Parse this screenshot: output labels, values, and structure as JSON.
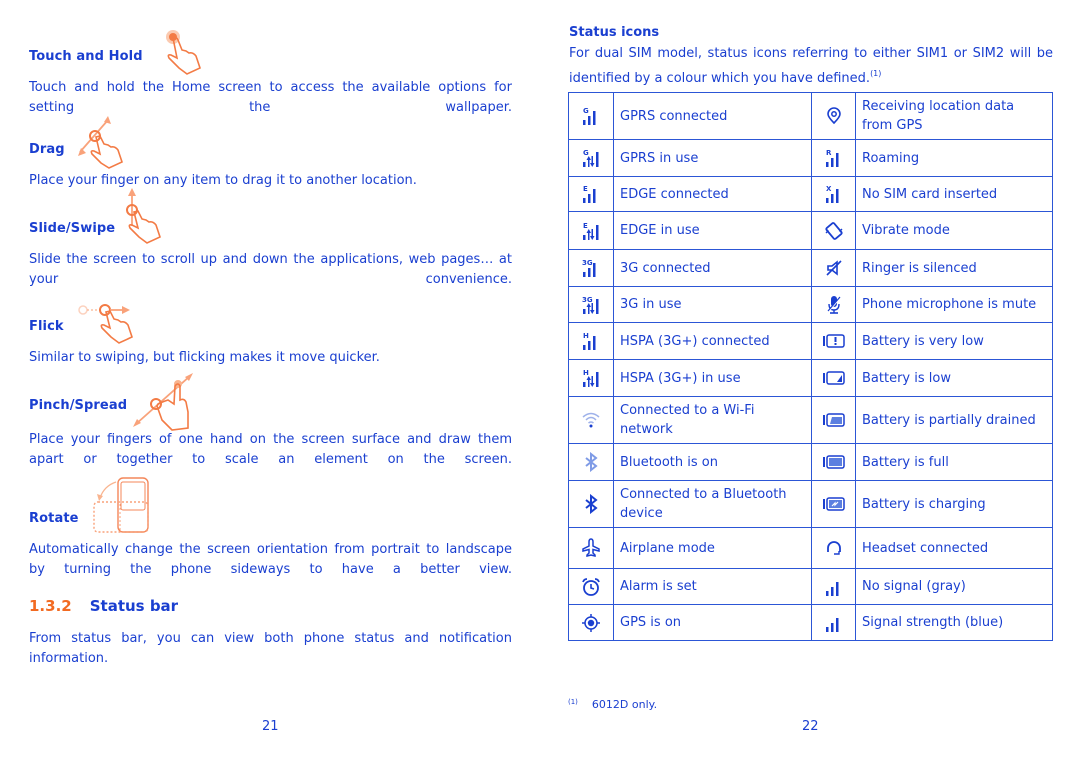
{
  "left_page": {
    "gestures": [
      {
        "title": "Touch and Hold",
        "icon": "touch-hold-hand-icon",
        "text": "Touch and hold the Home screen to access the available options for setting the wallpaper."
      },
      {
        "title": "Drag",
        "icon": "drag-hand-icon",
        "text": "Place your finger on any item to drag it to another location."
      },
      {
        "title": "Slide/Swipe",
        "icon": "swipe-hand-icon",
        "text": "Slide the screen to scroll up and down the applications, web pages… at your convenience."
      },
      {
        "title": "Flick",
        "icon": "flick-hand-icon",
        "text": "Similar to swiping, but flicking makes it move quicker."
      },
      {
        "title": "Pinch/Spread",
        "icon": "pinch-hand-icon",
        "text": "Place your fingers of one hand on the screen surface and draw them apart or together to scale an element on the screen."
      },
      {
        "title": "Rotate",
        "icon": "rotate-phone-icon",
        "text": "Automatically change the screen orientation from portrait to landscape by turning the phone sideways to have a better view."
      }
    ],
    "section": {
      "number": "1.3.2",
      "title": "Status bar",
      "text": "From status bar, you can view both phone status and notification information."
    },
    "page_number": "21"
  },
  "right_page": {
    "heading": "Status icons",
    "intro": "For dual SIM model, status icons referring to either SIM1 or SIM2 will be identified by a colour which you have defined.",
    "intro_footnote_ref": "(1)",
    "rows": [
      {
        "left": {
          "icon": "gprs-connected-icon",
          "label": "GPRS connected"
        },
        "right": {
          "icon": "location-pin-icon",
          "label": "Receiving location data from GPS"
        }
      },
      {
        "left": {
          "icon": "gprs-in-use-icon",
          "label": "GPRS in use"
        },
        "right": {
          "icon": "roaming-icon",
          "label": "Roaming"
        }
      },
      {
        "left": {
          "icon": "edge-connected-icon",
          "label": "EDGE connected"
        },
        "right": {
          "icon": "no-sim-icon",
          "label": "No SIM card inserted"
        }
      },
      {
        "left": {
          "icon": "edge-in-use-icon",
          "label": "EDGE in use"
        },
        "right": {
          "icon": "vibrate-icon",
          "label": "Vibrate mode"
        }
      },
      {
        "left": {
          "icon": "3g-connected-icon",
          "label": "3G connected"
        },
        "right": {
          "icon": "ringer-silenced-icon",
          "label": "Ringer is silenced"
        }
      },
      {
        "left": {
          "icon": "3g-in-use-icon",
          "label": "3G in use"
        },
        "right": {
          "icon": "mic-mute-icon",
          "label": "Phone microphone is mute"
        }
      },
      {
        "left": {
          "icon": "hspa-connected-icon",
          "label": "HSPA (3G+) connected"
        },
        "right": {
          "icon": "battery-very-low-icon",
          "label": "Battery is very low"
        }
      },
      {
        "left": {
          "icon": "hspa-in-use-icon",
          "label": "HSPA (3G+) in use"
        },
        "right": {
          "icon": "battery-low-icon",
          "label": "Battery is low"
        }
      },
      {
        "left": {
          "icon": "wifi-icon",
          "label": "Connected to a Wi-Fi network"
        },
        "right": {
          "icon": "battery-partial-icon",
          "label": "Battery is partially drained"
        }
      },
      {
        "left": {
          "icon": "bluetooth-on-icon",
          "label": "Bluetooth is on"
        },
        "right": {
          "icon": "battery-full-icon",
          "label": "Battery is full"
        }
      },
      {
        "left": {
          "icon": "bluetooth-connected-icon",
          "label": "Connected to a Bluetooth device"
        },
        "right": {
          "icon": "battery-charging-icon",
          "label": "Battery is charging"
        }
      },
      {
        "left": {
          "icon": "airplane-icon",
          "label": "Airplane mode"
        },
        "right": {
          "icon": "headset-icon",
          "label": "Headset connected"
        }
      },
      {
        "left": {
          "icon": "alarm-icon",
          "label": "Alarm is set"
        },
        "right": {
          "icon": "no-signal-icon",
          "label": "No signal (gray)"
        }
      },
      {
        "left": {
          "icon": "gps-on-icon",
          "label": "GPS is on"
        },
        "right": {
          "icon": "signal-strength-icon",
          "label": "Signal strength (blue)"
        }
      }
    ],
    "footnote": {
      "mark": "(1)",
      "text": "6012D only."
    },
    "page_number": "22"
  },
  "colors": {
    "text": "#1a3fd0",
    "accent": "#f26a21",
    "gesture_icon": "#f4875a",
    "table_border": "#2c56d6"
  }
}
